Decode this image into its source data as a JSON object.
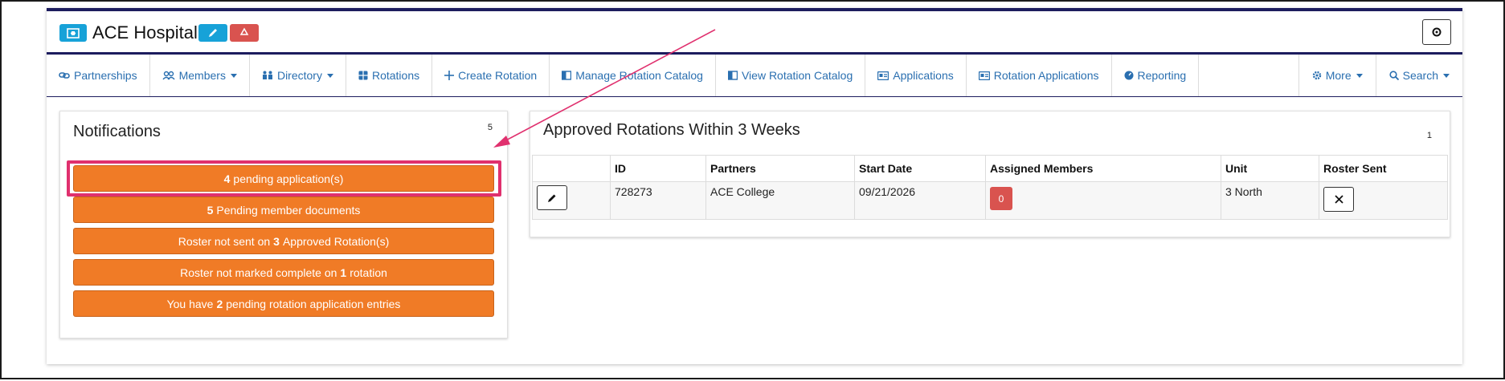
{
  "header": {
    "org_name": "ACE Hospital"
  },
  "nav": {
    "items": [
      {
        "label": "Partnerships",
        "icon": "link-icon"
      },
      {
        "label": "Members",
        "icon": "users-icon"
      },
      {
        "label": "Directory",
        "icon": "directory-icon"
      },
      {
        "label": "Rotations",
        "icon": "grid-icon"
      },
      {
        "label": "Create Rotation",
        "icon": "plus-icon"
      },
      {
        "label": "Manage Rotation Catalog",
        "icon": "book-icon"
      },
      {
        "label": "View Rotation Catalog",
        "icon": "book-icon"
      },
      {
        "label": "Applications",
        "icon": "id-card-icon"
      },
      {
        "label": "Rotation Applications",
        "icon": "id-card-icon"
      },
      {
        "label": "Reporting",
        "icon": "gauge-icon"
      },
      {
        "label": "More",
        "icon": "gear-icon"
      },
      {
        "label": "Search",
        "icon": "search-icon"
      }
    ]
  },
  "notifications": {
    "title": "Notifications",
    "count": "5",
    "items": [
      {
        "pre": "",
        "bold": "4",
        "post": "pending application(s)"
      },
      {
        "pre": "",
        "bold": "5",
        "post": "Pending member documents"
      },
      {
        "pre": "Roster not sent on",
        "bold": "3",
        "post": "Approved Rotation(s)"
      },
      {
        "pre": "Roster not marked complete on",
        "bold": "1",
        "post": "rotation"
      },
      {
        "pre": "You have",
        "bold": "2",
        "post": "pending rotation application entries"
      }
    ]
  },
  "rotations": {
    "title": "Approved Rotations Within 3 Weeks",
    "count": "1",
    "columns": [
      "",
      "ID",
      "Partners",
      "Start Date",
      "Assigned Members",
      "Unit",
      "Roster Sent"
    ],
    "rows": [
      {
        "id": "728273",
        "partners": "ACE College",
        "start_date": "09/21/2026",
        "assigned_members": "0",
        "unit": "3 North"
      }
    ]
  },
  "colors": {
    "accent_orange": "#f07b26",
    "highlight_pink": "#e0306e",
    "nav_link": "#2a6fb0",
    "info_blue": "#17a2d8",
    "danger_red": "#d9534f"
  }
}
